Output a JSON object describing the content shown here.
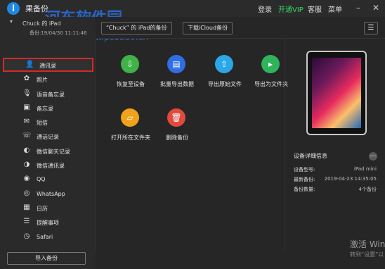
{
  "titlebar": {
    "app_title": "果备份",
    "menus": [
      "登录",
      "开通VIP",
      "客服",
      "菜单"
    ],
    "watermark": "河东软件园",
    "watermark2": "www.pc0359.cn"
  },
  "device": {
    "name": "Chuck 的 iPad",
    "backup_time": "备份:19/04/30 11:11:46"
  },
  "topbar": {
    "backup_tag": "“Chuck” 的 iPad的备份",
    "icloud_tag": "下载iCloud备份"
  },
  "sidebar": {
    "items": [
      {
        "label": "通讯录",
        "icon": "contacts-icon",
        "glyph": "👤"
      },
      {
        "label": "照片",
        "icon": "photos-icon",
        "glyph": "✿"
      },
      {
        "label": "语音备忘录",
        "icon": "microphone-icon",
        "glyph": "🎙"
      },
      {
        "label": "备忘录",
        "icon": "notes-icon",
        "glyph": "▣"
      },
      {
        "label": "短信",
        "icon": "sms-icon",
        "glyph": "✉"
      },
      {
        "label": "通话记录",
        "icon": "phone-icon",
        "glyph": "☏"
      },
      {
        "label": "微信聊天记录",
        "icon": "wechat-icon",
        "glyph": "◐"
      },
      {
        "label": "微信通讯录",
        "icon": "wechat-contacts-icon",
        "glyph": "◑"
      },
      {
        "label": "QQ",
        "icon": "qq-icon",
        "glyph": "◉"
      },
      {
        "label": "WhatsApp",
        "icon": "whatsapp-icon",
        "glyph": "◎"
      },
      {
        "label": "日历",
        "icon": "calendar-icon",
        "glyph": "▦"
      },
      {
        "label": "提醒事项",
        "icon": "reminders-icon",
        "glyph": "☰"
      },
      {
        "label": "Safari",
        "icon": "safari-icon",
        "glyph": "◷"
      }
    ],
    "import_button": "导入备份"
  },
  "actions": [
    {
      "label": "恢复至设备",
      "icon": "restore-device-icon",
      "color": "#3fb24a",
      "glyph": "⇩"
    },
    {
      "label": "批量导出数据",
      "icon": "batch-export-icon",
      "color": "#2f6ee6",
      "glyph": "▤"
    },
    {
      "label": "导出原始文件",
      "icon": "export-original-icon",
      "color": "#2aa7e6",
      "glyph": "⇧"
    },
    {
      "label": "导出为文件夹",
      "icon": "export-folder-icon",
      "color": "#2fb35b",
      "glyph": "▸"
    },
    {
      "label": "打开所在文件夹",
      "icon": "open-folder-icon",
      "color": "#f0a21a",
      "glyph": "▱"
    },
    {
      "label": "删除备份",
      "icon": "delete-backup-icon",
      "color": "#e04b3e",
      "glyph": "🗑"
    }
  ],
  "device_info": {
    "title": "设备详细信息",
    "rows": [
      {
        "k": "设备型号:",
        "v": "iPad mini"
      },
      {
        "k": "最新备份:",
        "v": "2019-04-23 14:35:05"
      },
      {
        "k": "备份数量:",
        "v": "4个备份"
      }
    ]
  },
  "system": {
    "activate": "激活 Wind",
    "activate2": "转到“设置”以"
  }
}
